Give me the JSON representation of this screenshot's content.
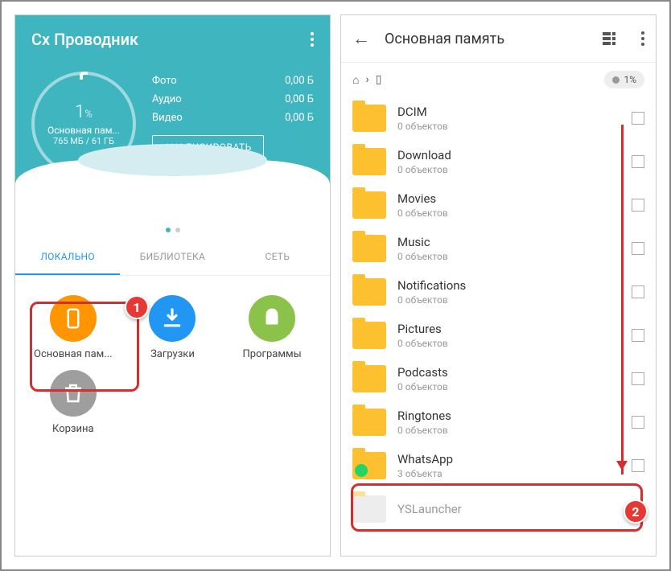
{
  "left": {
    "appTitle": "Cx Проводник",
    "circle": {
      "percent": "1",
      "unit": "%",
      "label": "Основная пам...",
      "sub": "765 МБ / 61 ГБ"
    },
    "stats": [
      {
        "k": "Фото",
        "v": "0,00 Б"
      },
      {
        "k": "Аудио",
        "v": "0,00 Б"
      },
      {
        "k": "Видео",
        "v": "0,00 Б"
      }
    ],
    "analyzeBtn": "АНАЛИЗИРОВАТЬ",
    "tabs": {
      "local": "ЛОКАЛЬНО",
      "library": "БИБЛИОТЕКА",
      "network": "СЕТЬ"
    },
    "grid": {
      "storage": "Основная пам...",
      "downloads": "Загрузки",
      "programs": "Программы",
      "trash": "Корзина"
    }
  },
  "right": {
    "title": "Основная память",
    "storagePct": "1%",
    "folders": [
      {
        "name": "DCIM",
        "sub": "0 объектов"
      },
      {
        "name": "Download",
        "sub": "0 объектов"
      },
      {
        "name": "Movies",
        "sub": "0 объектов"
      },
      {
        "name": "Music",
        "sub": "0 объектов"
      },
      {
        "name": "Notifications",
        "sub": "0 объектов"
      },
      {
        "name": "Pictures",
        "sub": "0 объектов"
      },
      {
        "name": "Podcasts",
        "sub": "0 объектов"
      },
      {
        "name": "Ringtones",
        "sub": "0 объектов"
      },
      {
        "name": "WhatsApp",
        "sub": "3 объекта"
      },
      {
        "name": "YSLauncher",
        "sub": ""
      }
    ]
  },
  "annotations": {
    "b1": "1",
    "b2": "2"
  }
}
